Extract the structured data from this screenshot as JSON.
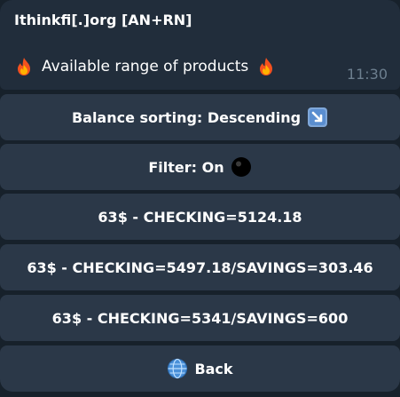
{
  "message": {
    "sender": "Ithinkfi[.]org [AN+RN]",
    "text": "Available range of products",
    "time": "11:30",
    "icons": [
      "fire-emoji",
      "fire-emoji"
    ]
  },
  "keyboard": {
    "buttons": [
      {
        "label": "Balance sorting: Descending",
        "icon": "arrow-down-right-emoji"
      },
      {
        "label": "Filter: On",
        "icon": "black-circle-emoji"
      },
      {
        "label": "63$ - CHECKING=5124.18"
      },
      {
        "label": "63$ - CHECKING=5497.18/SAVINGS=303.46"
      },
      {
        "label": "63$ - CHECKING=5341/SAVINGS=600"
      },
      {
        "label": "Back",
        "icon": "globe-emoji"
      }
    ]
  },
  "colors": {
    "background": "#17212b",
    "message_bubble": "#212d3b",
    "button": "#2b3848",
    "time": "#6d7f8f",
    "text": "#ffffff"
  }
}
